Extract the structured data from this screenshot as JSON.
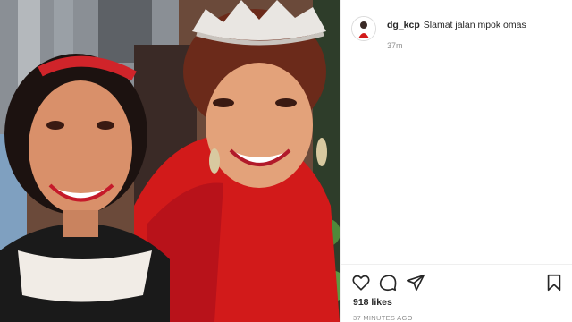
{
  "post": {
    "photo": {
      "alt": "photo-of-two-smiling-women"
    },
    "comment": {
      "username": "dg_kcp",
      "text": "Slamat jalan mpok omas",
      "time_ago": "37m"
    },
    "actions": {
      "like_icon": "heart-icon",
      "comment_icon": "speech-bubble-icon",
      "share_icon": "paper-plane-icon",
      "save_icon": "bookmark-icon"
    },
    "likes": "918 likes",
    "timestamp": "37 MINUTES AGO"
  },
  "colors": {
    "text": "#262626",
    "muted": "#8e8e8e",
    "border": "#efefef",
    "dress_red": "#d21a1a"
  }
}
